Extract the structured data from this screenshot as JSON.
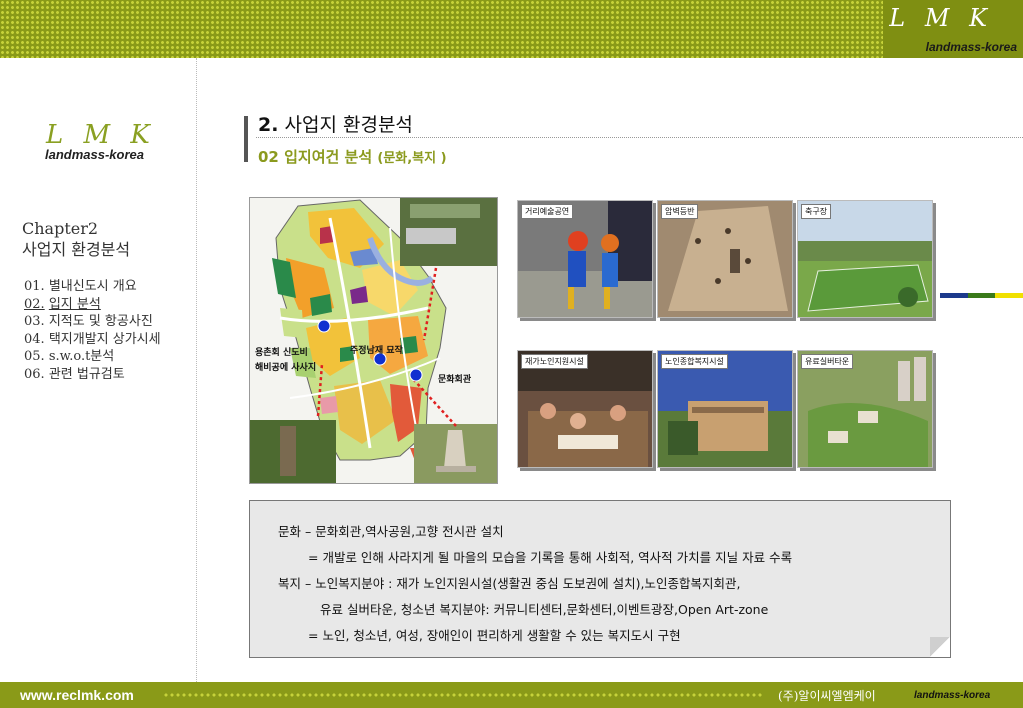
{
  "header": {
    "logo": "L M K",
    "brand": "landmass-korea"
  },
  "sidebar": {
    "logo": "L M K",
    "brand": "landmass-korea",
    "chapter": "Chapter2",
    "chapter_title": "사업지 환경분석",
    "toc": [
      {
        "num": "01.",
        "label": "별내신도시 개요"
      },
      {
        "num": "02.",
        "label": "입지 분석"
      },
      {
        "num": "03.",
        "label": "지적도 및 항공사진"
      },
      {
        "num": "04.",
        "label": "택지개발지 상가시세"
      },
      {
        "num": "05.",
        "label": "s.w.o.t분석"
      },
      {
        "num": "06.",
        "label": "관련 법규검토"
      }
    ]
  },
  "heading": {
    "number": "2.",
    "title": "사업지 환경분석",
    "sub_number": "02",
    "sub_title": "입지여건 분석",
    "sub_note": "(문화,복지 )"
  },
  "map": {
    "label_left_1": "용촌회 신도비",
    "label_left_2": "해비공에 사사지",
    "label_top": "주정남재 묘작",
    "label_right": "문화회관"
  },
  "photos": [
    {
      "label": "거리예술공연"
    },
    {
      "label": "암벽등반"
    },
    {
      "label": "축구장"
    },
    {
      "label": "재가노인지원시설"
    },
    {
      "label": "노인종합복지시설"
    },
    {
      "label": "유료실버타운"
    }
  ],
  "note": {
    "line1": "문화 – 문화회관,역사공원,고향 전시관 설치",
    "line2": "= 개발로 인해 사라지게 될 마을의 모습을 기록을 통해 사회적, 역사적 가치를 지닐 자료 수록",
    "line3": "복지 – 노인복지분야 : 재가 노인지원시설(생활권 중심 도보권에 설치),노인종합복지회관,",
    "line4": "유료 실버타운, 청소년 복지분야: 커뮤니티센터,문화센터,이벤트광장,Open Art-zone",
    "line5": "= 노인, 청소년, 여성, 장애인이 편리하게 생활할 수 있는 복지도시 구현"
  },
  "footer": {
    "url": "www.reclmk.com",
    "company": "(주)알이씨엘엠케이",
    "brand": "landmass-korea"
  },
  "colors": {
    "olive": "#8a9a18",
    "accent_green": "#8aa022",
    "stripe_blue": "#1c3a8c",
    "stripe_green": "#3a7a1a",
    "stripe_yellow": "#f0e000"
  }
}
